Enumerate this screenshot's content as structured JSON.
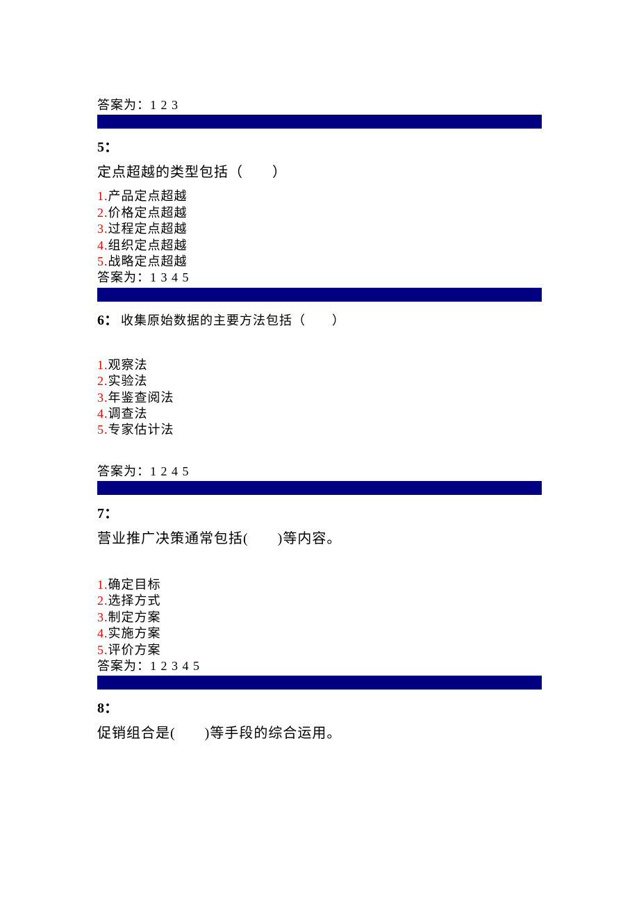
{
  "q4": {
    "answer": "答案为：1 2 3"
  },
  "q5": {
    "number": "5：",
    "question": "定点超越的类型包括（　　）",
    "opts": {
      "n1": "1.",
      "t1": "产品定点超越",
      "n2": "2.",
      "t2": "价格定点超越",
      "n3": "3.",
      "t3": "过程定点超越",
      "n4": "4.",
      "t4": "组织定点超越",
      "n5": "5.",
      "t5": "战略定点超越"
    },
    "answer": "答案为：1 3 4 5"
  },
  "q6": {
    "number": "6：",
    "question": "收集原始数据的主要方法包括（　　）",
    "opts": {
      "n1": "1.",
      "t1": "观察法",
      "n2": "2.",
      "t2": "实验法",
      "n3": "3.",
      "t3": "年鉴查阅法",
      "n4": "4.",
      "t4": "调查法",
      "n5": "5.",
      "t5": "专家估计法"
    },
    "answer": "答案为：1 2 4 5"
  },
  "q7": {
    "number": "7：",
    "question": "营业推广决策通常包括(　　)等内容。",
    "opts": {
      "n1": "1.",
      "t1": "确定目标",
      "n2": "2.",
      "t2": "选择方式",
      "n3": "3.",
      "t3": "制定方案",
      "n4": "4.",
      "t4": "实施方案",
      "n5": "5.",
      "t5": "评价方案"
    },
    "answer": "答案为：1 2 3 4 5"
  },
  "q8": {
    "number": "8：",
    "question": "促销组合是(　　)等手段的综合运用。"
  }
}
